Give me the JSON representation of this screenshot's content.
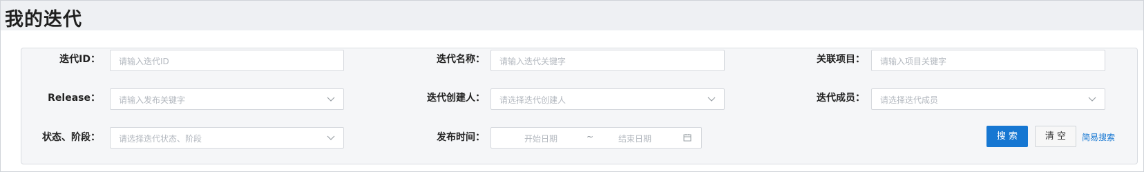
{
  "page": {
    "title": "我的迭代"
  },
  "form": {
    "iteration_id": {
      "label": "迭代ID：",
      "placeholder": "请输入迭代ID"
    },
    "iteration_name": {
      "label": "迭代名称：",
      "placeholder": "请输入迭代关键字"
    },
    "related_project": {
      "label": "关联项目：",
      "placeholder": "请输入项目关键字"
    },
    "release": {
      "label": "Release：",
      "placeholder": "请输入发布关键字"
    },
    "iteration_creator": {
      "label": "迭代创建人：",
      "placeholder": "请选择迭代创建人"
    },
    "iteration_member": {
      "label": "迭代成员：",
      "placeholder": "请选择迭代成员"
    },
    "status_stage": {
      "label": "状态、阶段：",
      "placeholder": "请选择迭代状态、阶段"
    },
    "publish_time": {
      "label": "发布时间：",
      "start_placeholder": "开始日期",
      "separator": "~",
      "end_placeholder": "结束日期"
    }
  },
  "actions": {
    "search_label": "搜 索",
    "clear_label": "清 空",
    "simple_search_label": "简易搜索"
  },
  "icons": {
    "dropdown": "chevron-down-icon",
    "calendar": "calendar-icon"
  },
  "colors": {
    "primary": "#1677d2",
    "panel_bg": "#f5f6f8",
    "title_bar_bg": "#eef0f3"
  }
}
